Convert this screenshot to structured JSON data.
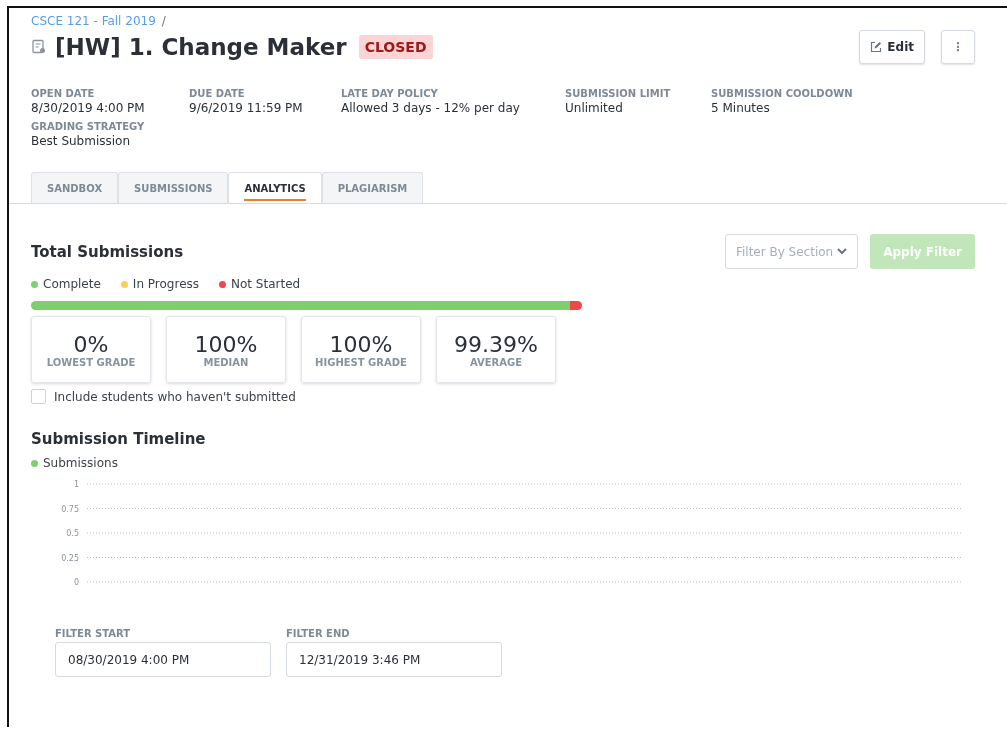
{
  "breadcrumb": {
    "link": "CSCE 121 - Fall 2019",
    "separator": "/"
  },
  "title": "[HW] 1. Change Maker",
  "status_badge": "CLOSED",
  "actions": {
    "edit": "Edit",
    "more": "⋮"
  },
  "details": [
    {
      "label": "OPEN DATE",
      "value": "8/30/2019 4:00 PM"
    },
    {
      "label": "DUE DATE",
      "value": "9/6/2019 11:59 PM"
    },
    {
      "label": "LATE DAY POLICY",
      "value": "Allowed 3 days - 12% per day"
    },
    {
      "label": "SUBMISSION LIMIT",
      "value": "Unlimited"
    },
    {
      "label": "SUBMISSION COOLDOWN",
      "value": "5 Minutes"
    },
    {
      "label": "GRADING STRATEGY",
      "value": "Best Submission"
    }
  ],
  "tabs": [
    {
      "label": "SANDBOX",
      "selected": false
    },
    {
      "label": "SUBMISSIONS",
      "selected": false
    },
    {
      "label": "ANALYTICS",
      "selected": true
    },
    {
      "label": "PLAGIARISM",
      "selected": false
    }
  ],
  "total_submissions": {
    "title": "Total Submissions",
    "filter_select": {
      "placeholder": "Filter By Section"
    },
    "apply_button": {
      "label": "Apply Filter",
      "disabled": true
    },
    "legend": [
      {
        "label": "Complete",
        "color": "#7ed06f",
        "level": 0.978
      },
      {
        "label": "In Progress",
        "color": "#f8d05a",
        "level": 0
      },
      {
        "label": "Not Started",
        "color": "#f04848",
        "level": 0.022
      }
    ],
    "stats": [
      {
        "value": "0%",
        "label": "LOWEST GRADE"
      },
      {
        "value": "100%",
        "label": "MEDIAN"
      },
      {
        "value": "100%",
        "label": "HIGHEST GRADE"
      },
      {
        "value": "99.39%",
        "label": "AVERAGE"
      }
    ],
    "include_checkbox": {
      "label": "Include students who haven't submitted",
      "checked": false
    }
  },
  "timeline": {
    "title": "Submission Timeline",
    "chart_data": {
      "type": "line",
      "series": [
        {
          "name": "Submissions",
          "color": "#7ed06f"
        }
      ],
      "ylim": [
        0,
        1
      ],
      "grid": true,
      "yticks": [
        1,
        0.75,
        0.5,
        0.25,
        0
      ]
    },
    "fields": [
      {
        "label": "FILTER START",
        "value": "08/30/2019 4:00 PM"
      },
      {
        "label": "FILTER END",
        "value": "12/31/2019 3:46 PM"
      }
    ]
  }
}
